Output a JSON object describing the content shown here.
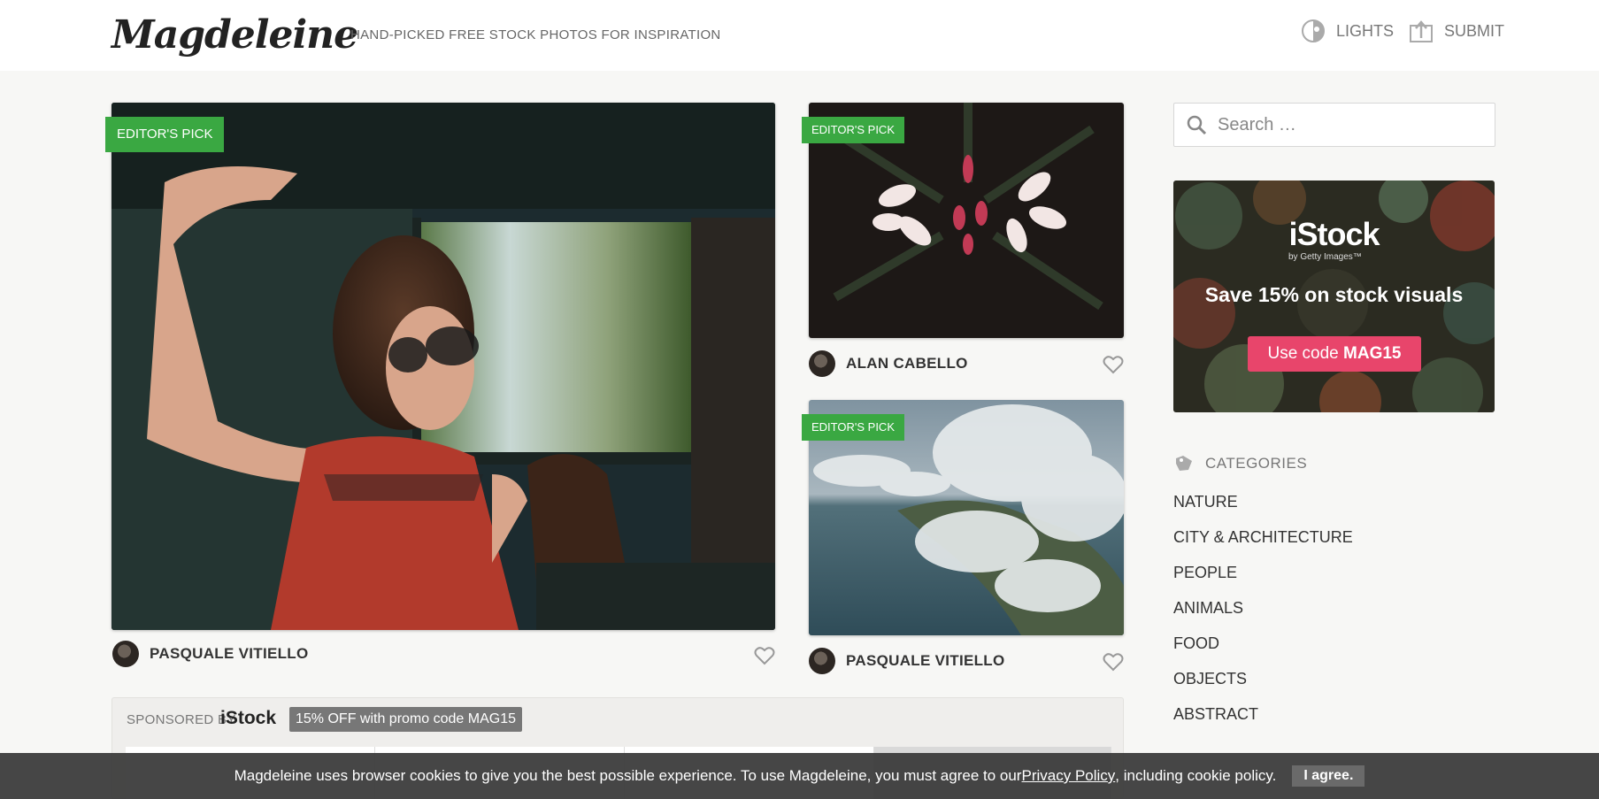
{
  "header": {
    "logo": "Magdeleine",
    "tagline": "HAND-PICKED FREE STOCK PHOTOS FOR INSPIRATION",
    "lights_label": "LIGHTS",
    "submit_label": "SUBMIT"
  },
  "photos": [
    {
      "badge": "EDITOR'S PICK",
      "author": "PASQUALE VITIELLO"
    },
    {
      "badge": "EDITOR'S PICK",
      "author": "ALAN CABELLO"
    },
    {
      "badge": "EDITOR'S PICK",
      "author": "PASQUALE VITIELLO"
    }
  ],
  "sponsored": {
    "label": "SPONSORED BY",
    "brand": "iStock",
    "promo": "15% OFF with promo code MAG15"
  },
  "sidebar": {
    "search_placeholder": "Search …",
    "ad": {
      "logo": "iStock",
      "logo_sub": "by Getty Images™",
      "headline": "Save 15% on stock visuals",
      "cta_prefix": "Use code ",
      "cta_code": "MAG15"
    },
    "categories_title": "CATEGORIES",
    "categories": [
      "NATURE",
      "CITY & ARCHITECTURE",
      "PEOPLE",
      "ANIMALS",
      "FOOD",
      "OBJECTS",
      "ABSTRACT"
    ]
  },
  "cookie": {
    "text_before": "Magdeleine uses browser cookies to give you the best possible experience. To use Magdeleine, you must agree to our ",
    "link": "Privacy Policy",
    "text_after": ", including cookie policy.",
    "agree": "I agree."
  },
  "colors": {
    "badge_green": "#3aa842",
    "cta_pink": "#e8456b",
    "page_bg": "#f7f7f5"
  }
}
